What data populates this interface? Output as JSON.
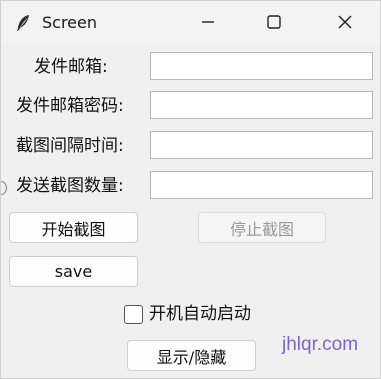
{
  "window": {
    "title": "Screen",
    "icon": "feather-icon",
    "controls": [
      "minimize-icon",
      "maximize-icon",
      "close-icon"
    ]
  },
  "form": {
    "sender_email_label": "发件邮箱:",
    "sender_email_value": "",
    "sender_password_label": "发件邮箱密码:",
    "sender_password_value": "",
    "interval_label": "截图间隔时间:",
    "interval_value": "",
    "count_label": "发送截图数量:",
    "count_value": ""
  },
  "buttons": {
    "start_label": "开始截图",
    "stop_label": "停止截图",
    "save_label": "save",
    "toggle_label": "显示/隐藏"
  },
  "autostart": {
    "label": "开机自动启动",
    "checked": false
  },
  "watermark": {
    "text": "jhlqr.com"
  }
}
